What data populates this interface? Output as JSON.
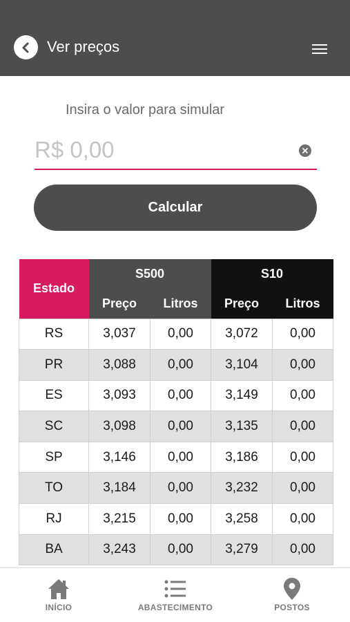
{
  "header": {
    "title": "Ver preços",
    "back_icon": "chevron-left-icon",
    "menu_icon": "hamburger-menu-icon"
  },
  "simulator": {
    "prompt": "Insira o valor para simular",
    "placeholder": "R$ 0,00",
    "value": "",
    "clear_icon": "clear-icon",
    "button_label": "Calcular"
  },
  "table": {
    "estado_header": "Estado",
    "groups": [
      {
        "label": "S500",
        "sub": [
          "Preço",
          "Litros"
        ]
      },
      {
        "label": "S10",
        "sub": [
          "Preço",
          "Litros"
        ]
      }
    ],
    "rows": [
      {
        "estado": "RS",
        "s500_preco": "3,037",
        "s500_litros": "0,00",
        "s10_preco": "3,072",
        "s10_litros": "0,00"
      },
      {
        "estado": "PR",
        "s500_preco": "3,088",
        "s500_litros": "0,00",
        "s10_preco": "3,104",
        "s10_litros": "0,00"
      },
      {
        "estado": "ES",
        "s500_preco": "3,093",
        "s500_litros": "0,00",
        "s10_preco": "3,149",
        "s10_litros": "0,00"
      },
      {
        "estado": "SC",
        "s500_preco": "3,098",
        "s500_litros": "0,00",
        "s10_preco": "3,135",
        "s10_litros": "0,00"
      },
      {
        "estado": "SP",
        "s500_preco": "3,146",
        "s500_litros": "0,00",
        "s10_preco": "3,186",
        "s10_litros": "0,00"
      },
      {
        "estado": "TO",
        "s500_preco": "3,184",
        "s500_litros": "0,00",
        "s10_preco": "3,232",
        "s10_litros": "0,00"
      },
      {
        "estado": "RJ",
        "s500_preco": "3,215",
        "s500_litros": "0,00",
        "s10_preco": "3,258",
        "s10_litros": "0,00"
      },
      {
        "estado": "BA",
        "s500_preco": "3,243",
        "s500_litros": "0,00",
        "s10_preco": "3,279",
        "s10_litros": "0,00"
      }
    ]
  },
  "nav": {
    "items": [
      {
        "label": "INÍCIO",
        "icon": "home-icon"
      },
      {
        "label": "ABASTECIMENTO",
        "icon": "list-icon"
      },
      {
        "label": "POSTOS",
        "icon": "map-pin-icon"
      }
    ]
  },
  "colors": {
    "header_bg": "#4d4d4d",
    "accent": "#d81b60",
    "s10_bg": "#111111",
    "row_alt": "#e0e0e0"
  }
}
